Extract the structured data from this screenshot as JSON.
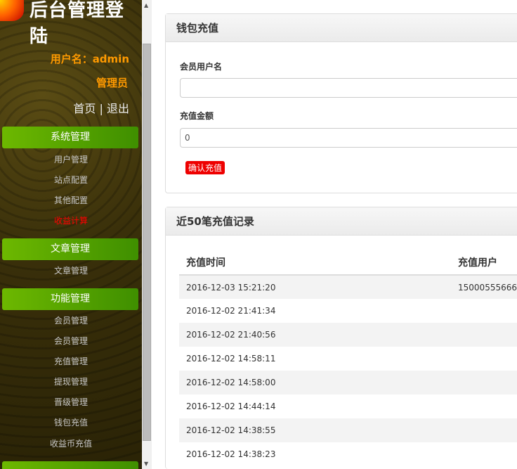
{
  "header": {
    "title": "后台管理登陆",
    "username": "用户名：admin",
    "role": "管理员",
    "home": "首页",
    "separator": "|",
    "logout": "退出"
  },
  "sidebar": {
    "groups": [
      {
        "label": "系统管理",
        "items": [
          "用户管理",
          "站点配置",
          "其他配置",
          "收益计算"
        ]
      },
      {
        "label": "文章管理",
        "items": [
          "文章管理"
        ]
      },
      {
        "label": "功能管理",
        "items": [
          "会员管理",
          "会员管理",
          "充值管理",
          "提现管理",
          "晋级管理",
          "钱包充值",
          "收益币充值"
        ]
      }
    ]
  },
  "wallet": {
    "title": "钱包充值",
    "username_label": "会员用户名",
    "username_value": "",
    "amount_label": "充值金额",
    "amount_value": "0",
    "submit": "确认充值"
  },
  "records": {
    "title": "近50笔充值记录",
    "columns": [
      "充值时间",
      "充值用户"
    ],
    "rows": [
      [
        "2016-12-03 15:21:20",
        "15000555666"
      ],
      [
        "2016-12-02 21:41:34",
        ""
      ],
      [
        "2016-12-02 21:40:56",
        ""
      ],
      [
        "2016-12-02 14:58:11",
        ""
      ],
      [
        "2016-12-02 14:58:00",
        ""
      ],
      [
        "2016-12-02 14:44:14",
        ""
      ],
      [
        "2016-12-02 14:38:55",
        ""
      ],
      [
        "2016-12-02 14:38:23",
        ""
      ]
    ]
  }
}
